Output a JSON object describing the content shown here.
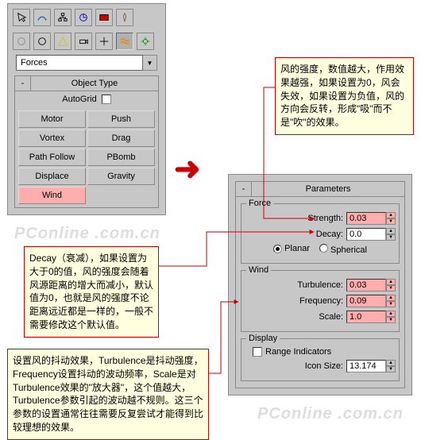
{
  "left_panel": {
    "dropdown": "Forces",
    "rollout_title": "Object Type",
    "autogrid_label": "AutoGrid",
    "buttons": [
      "Motor",
      "Push",
      "Vortex",
      "Drag",
      "Path Follow",
      "PBomb",
      "Displace",
      "Gravity",
      "Wind"
    ]
  },
  "right_panel": {
    "rollout_title": "Parameters",
    "force": {
      "group": "Force",
      "strength_label": "Strength:",
      "strength": "0.03",
      "decay_label": "Decay:",
      "decay": "0.0",
      "planar": "Planar",
      "spherical": "Spherical"
    },
    "wind": {
      "group": "Wind",
      "turbulence_label": "Turbulence:",
      "turbulence": "0.03",
      "frequency_label": "Frequency:",
      "frequency": "0.09",
      "scale_label": "Scale:",
      "scale": "1.0"
    },
    "display": {
      "group": "Display",
      "range_label": "Range Indicators",
      "icon_size_label": "Icon Size:",
      "icon_size": "13.174"
    }
  },
  "notes": {
    "n1": "风的强度，数值越大，作用效果越强，如果设置为0，风会失效，如果设置为负值，风的方向会反转，形成\"吸\"而不是\"吹\"的效果。",
    "n2": "Decay（衰减），如果设置为大于0的值，风的强度会随着风源距离的增大而减小，默认值为0，也就是风的强度不论距离远近都是一样的，一般不需要修改这个默认值。",
    "n3": "设置风的抖动效果，Turbulence是抖动强度，Frequency设置抖动的波动频率，Scale是对Turbulence效果的\"放大器\"，这个值越大，Turbulence参数引起的波动越不规则。这三个参数的设置通常往往需要反复尝试才能得到比较理想的效果。"
  },
  "watermark": "PConline .com.cn",
  "arrow": "➜"
}
